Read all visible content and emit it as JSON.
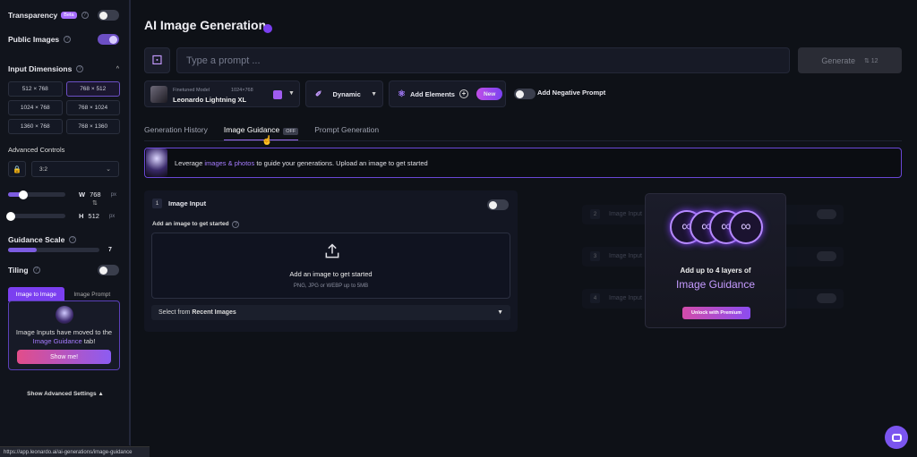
{
  "sidebar": {
    "transparency": {
      "label": "Transparency",
      "badge": "Beta",
      "on": false
    },
    "public_images": {
      "label": "Public Images",
      "on": true
    },
    "input_dimensions": {
      "label": "Input Dimensions",
      "options": [
        "512 × 768",
        "768 × 512",
        "1024 × 768",
        "768 × 1024",
        "1360 × 768",
        "768 × 1360"
      ],
      "selected": "768 × 512"
    },
    "advanced_controls": {
      "label": "Advanced Controls",
      "ratio": "3:2"
    },
    "width": {
      "label": "W",
      "value": "768",
      "unit": "px"
    },
    "height": {
      "label": "H",
      "value": "512",
      "unit": "px"
    },
    "guidance_scale": {
      "label": "Guidance Scale",
      "value": "7"
    },
    "tiling": {
      "label": "Tiling",
      "on": false
    },
    "tabs": [
      "Image to Image",
      "Image Prompt"
    ],
    "notice": {
      "pre": "Image Inputs have moved to the ",
      "link": "Image Guidance",
      "post": " tab!",
      "button": "Show me!"
    },
    "show_advanced": "Show Advanced Settings ▲"
  },
  "status_url": "https://app.leonardo.ai/ai-generations/image-guidance",
  "main": {
    "title": "AI Image Generation",
    "prompt_placeholder": "Type a prompt ...",
    "generate": {
      "label": "Generate",
      "cost": "⇅ 12"
    },
    "model": {
      "sub": "Finetuned Model",
      "res": "1024×768",
      "name": "Leonardo Lightning XL"
    },
    "style": "Dynamic",
    "elements": {
      "label": "Add Elements",
      "badge": "New"
    },
    "negative_prompt": "Add Negative Prompt",
    "tabs": [
      {
        "label": "Generation History"
      },
      {
        "label": "Image Guidance",
        "badge": "OFF"
      },
      {
        "label": "Prompt Generation"
      }
    ],
    "banner": {
      "pre": "Leverage ",
      "link": "images & photos",
      "post": " to guide your generations. Upload an image to get started"
    },
    "image_input": {
      "num": "1",
      "title": "Image Input",
      "add_label": "Add an image to get started",
      "dz_main": "Add an image to get started",
      "dz_sub": "PNG, JPG or WEBP up to 5MB",
      "recent_pre": "Select from ",
      "recent_bold": "Recent Images"
    },
    "ghost_inputs": [
      {
        "num": "2",
        "label": "Image Input"
      },
      {
        "num": "3",
        "label": "Image Input"
      },
      {
        "num": "4",
        "label": "Image Input"
      }
    ],
    "premium": {
      "line1": "Add up to 4 layers of",
      "line2": "Image Guidance",
      "button": "Unlock with Premium"
    }
  }
}
